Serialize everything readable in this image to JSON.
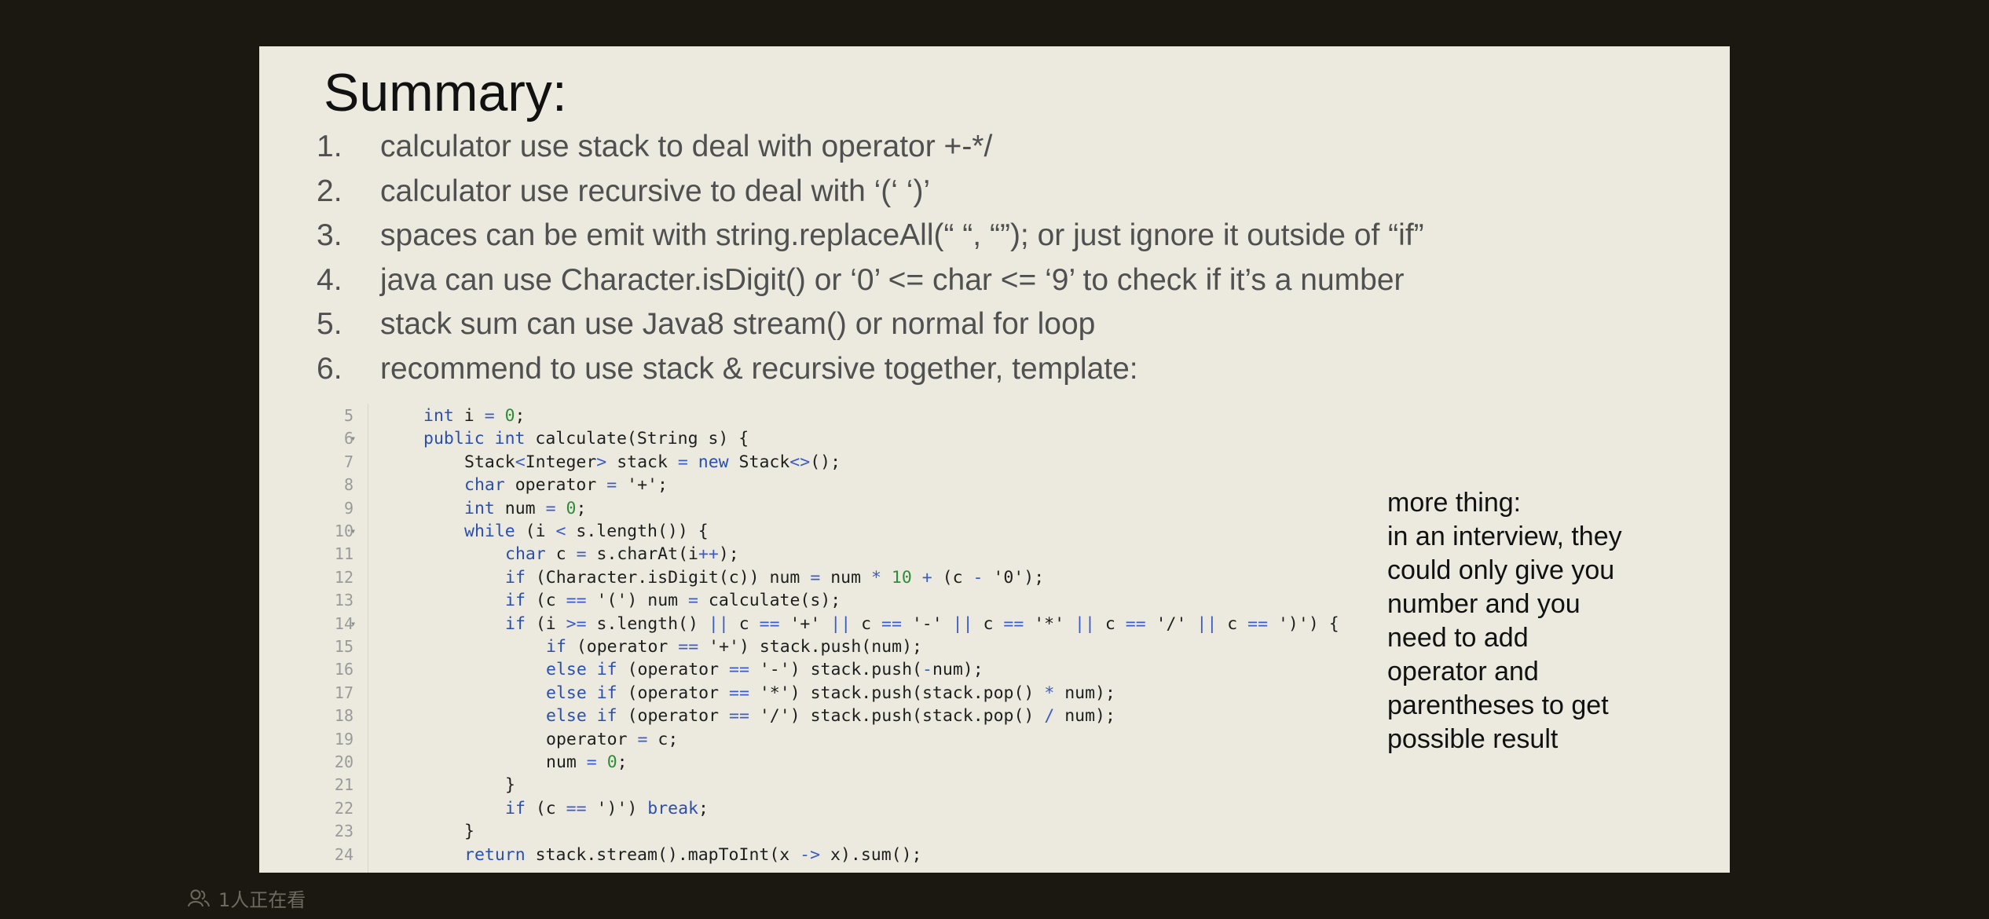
{
  "slide": {
    "title": "Summary:",
    "items": [
      {
        "num": "1.",
        "text": "calculator use stack to deal with operator +-*/"
      },
      {
        "num": "2.",
        "text": "calculator use recursive to deal with ‘(‘ ‘)’"
      },
      {
        "num": "3.",
        "text": "spaces can be emit with string.replaceAll(“ “, “”); or just ignore it outside of “if”"
      },
      {
        "num": "4.",
        "text": "java can use Character.isDigit() or ‘0’ <= char <= ‘9’ to check if it’s a number"
      },
      {
        "num": "5.",
        "text": "stack sum can use Java8 stream() or normal for loop"
      },
      {
        "num": "6.",
        "text": "recommend to use stack & recursive together, template:"
      }
    ],
    "code": [
      {
        "ln": "5",
        "fold": false,
        "indent": 0,
        "text": "int i = 0;"
      },
      {
        "ln": "6",
        "fold": true,
        "indent": 0,
        "text": "public int calculate(String s) {"
      },
      {
        "ln": "7",
        "fold": false,
        "indent": 1,
        "text": "Stack<Integer> stack = new Stack<>();"
      },
      {
        "ln": "8",
        "fold": false,
        "indent": 1,
        "text": "char operator = '+';"
      },
      {
        "ln": "9",
        "fold": false,
        "indent": 1,
        "text": "int num = 0;"
      },
      {
        "ln": "10",
        "fold": true,
        "indent": 1,
        "text": "while (i < s.length()) {"
      },
      {
        "ln": "11",
        "fold": false,
        "indent": 2,
        "text": "char c = s.charAt(i++);"
      },
      {
        "ln": "12",
        "fold": false,
        "indent": 2,
        "text": "if (Character.isDigit(c)) num = num * 10 + (c - '0');"
      },
      {
        "ln": "13",
        "fold": false,
        "indent": 2,
        "text": "if (c == '(') num = calculate(s);"
      },
      {
        "ln": "14",
        "fold": true,
        "indent": 2,
        "text": "if (i >= s.length() || c == '+' || c == '-' || c == '*' || c == '/' || c == ')') {"
      },
      {
        "ln": "15",
        "fold": false,
        "indent": 3,
        "text": "if (operator == '+') stack.push(num);"
      },
      {
        "ln": "16",
        "fold": false,
        "indent": 3,
        "text": "else if (operator == '-') stack.push(-num);"
      },
      {
        "ln": "17",
        "fold": false,
        "indent": 3,
        "text": "else if (operator == '*') stack.push(stack.pop() * num);"
      },
      {
        "ln": "18",
        "fold": false,
        "indent": 3,
        "text": "else if (operator == '/') stack.push(stack.pop() / num);"
      },
      {
        "ln": "19",
        "fold": false,
        "indent": 3,
        "text": "operator = c;"
      },
      {
        "ln": "20",
        "fold": false,
        "indent": 3,
        "text": "num = 0;"
      },
      {
        "ln": "21",
        "fold": false,
        "indent": 2,
        "text": "}"
      },
      {
        "ln": "22",
        "fold": false,
        "indent": 2,
        "text": "if (c == ')') break;"
      },
      {
        "ln": "23",
        "fold": false,
        "indent": 1,
        "text": "}"
      },
      {
        "ln": "24",
        "fold": false,
        "indent": 1,
        "text": "return stack.stream().mapToInt(x -> x).sum();"
      }
    ],
    "note": {
      "lines": [
        "more thing:",
        "in an interview, they",
        "could only give you",
        "number and you",
        "need to add",
        "operator and",
        "parentheses to get",
        "possible result"
      ]
    }
  },
  "viewer_count": {
    "icon": "people-icon",
    "text": "1人正在看"
  },
  "colors": {
    "slide_bg": "#eceade",
    "page_bg": "#1b1811",
    "code_keyword": "#2b4fb0",
    "code_number": "#2e8c3a",
    "code_operator": "#3b5bc9",
    "code_string": "#1e1e1e"
  }
}
